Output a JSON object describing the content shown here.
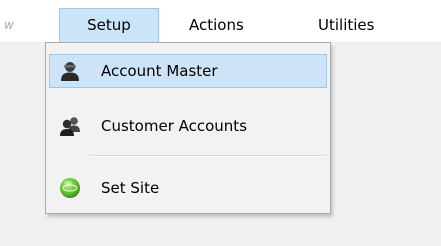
{
  "menubar": {
    "prev_label": "w",
    "setup_label": "Setup",
    "actions_label": "Actions",
    "utilities_label": "Utilities"
  },
  "dropdown": {
    "items": [
      {
        "label": "Account Master",
        "icon": "account-user-icon",
        "highlighted": true
      },
      {
        "label": "Customer Accounts",
        "icon": "customers-icon",
        "highlighted": false
      },
      {
        "label": "Set Site",
        "icon": "site-icon",
        "highlighted": false
      }
    ]
  },
  "colors": {
    "menu_highlight": "#cce4f7",
    "menu_highlight_border": "#99c9ef",
    "dropdown_bg": "#f2f2f2"
  }
}
